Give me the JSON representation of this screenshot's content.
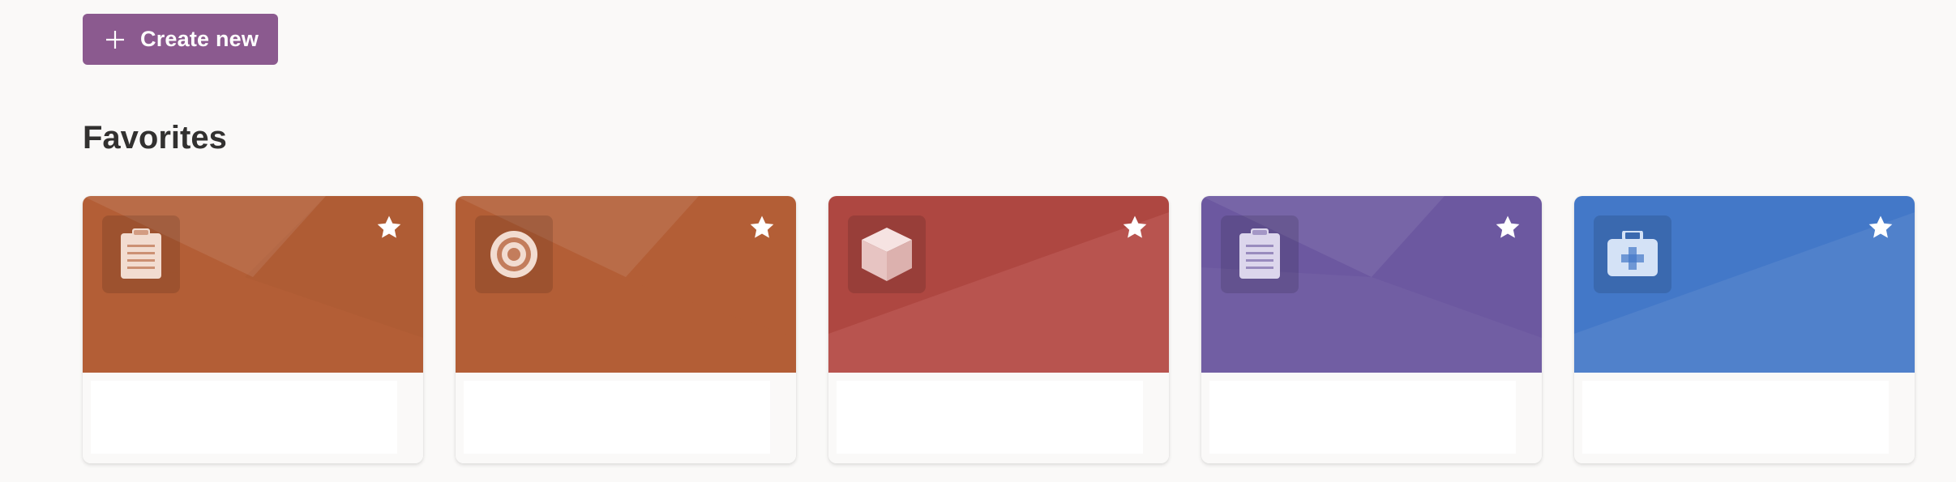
{
  "toolbar": {
    "create_label": "Create new",
    "create_color": "#8b5a8f"
  },
  "favorites": {
    "title": "Favorites",
    "cards": [
      {
        "icon": "clipboard-icon",
        "color": "#b35e36",
        "favorited": true,
        "body_text": ""
      },
      {
        "icon": "target-icon",
        "color": "#b35e36",
        "favorited": true,
        "body_text": ""
      },
      {
        "icon": "cube-icon",
        "color": "#b44a44",
        "favorited": true,
        "body_text": ""
      },
      {
        "icon": "clipboard-icon",
        "color": "#6c58a0",
        "favorited": true,
        "body_text": ""
      },
      {
        "icon": "medical-kit-icon",
        "color": "#4378c8",
        "favorited": true,
        "body_text": ""
      }
    ]
  }
}
